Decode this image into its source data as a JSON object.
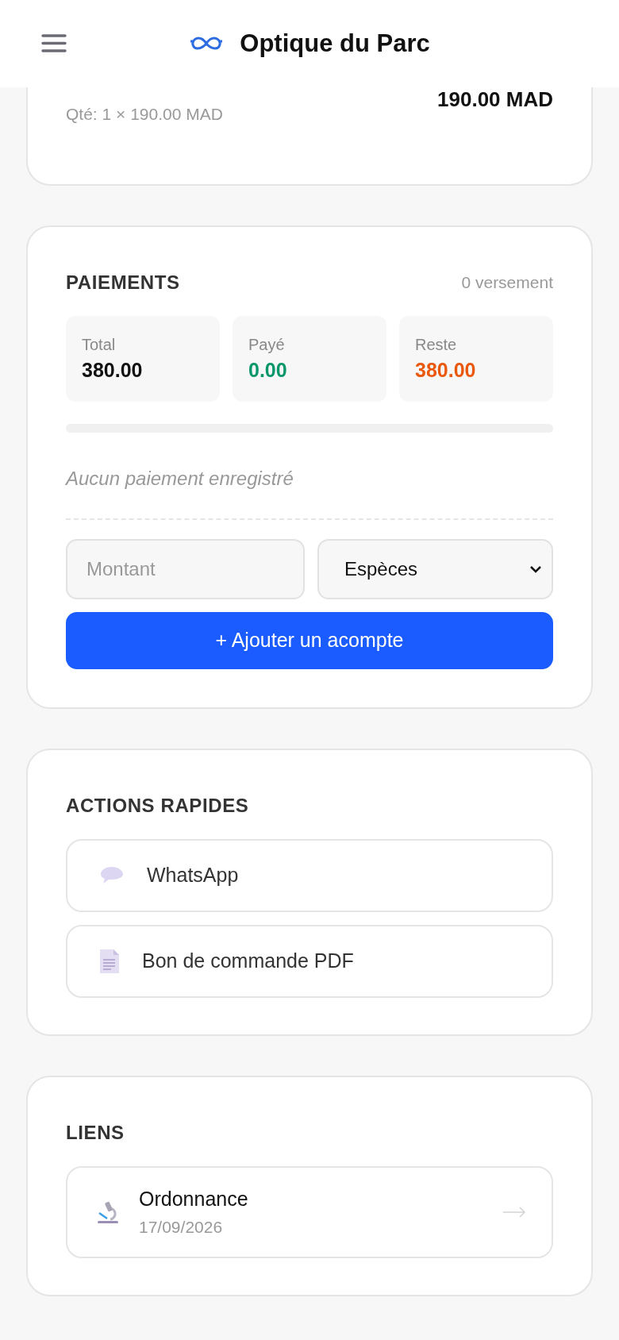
{
  "header": {
    "title": "Optique du Parc"
  },
  "line_item": {
    "quantity": "Qté: 1 × 190.00 MAD",
    "total": "190.00 MAD"
  },
  "payments": {
    "title": "PAIEMENTS",
    "count": "0 versement",
    "stats": [
      {
        "label": "Total",
        "value": "380.00",
        "color": "#111111"
      },
      {
        "label": "Payé",
        "value": "0.00",
        "color": "#059669"
      },
      {
        "label": "Reste",
        "value": "380.00",
        "color": "#ea580c"
      }
    ],
    "progress": {
      "level": 0
    },
    "empty": "Aucun paiement enregistré",
    "amount": {
      "placeholder": "Montant"
    },
    "method": {
      "value": "Espèces"
    },
    "add_button": "+ Ajouter un acompte"
  },
  "quick_actions": {
    "title": "ACTIONS RAPIDES",
    "items": [
      {
        "kind": "message",
        "label": "WhatsApp"
      },
      {
        "kind": "document",
        "label": "Bon de commande PDF"
      }
    ]
  },
  "links": {
    "title": "LIENS",
    "items": [
      {
        "kind": "prescription",
        "label": "Ordonnance",
        "date": "17/09/2026"
      }
    ]
  }
}
